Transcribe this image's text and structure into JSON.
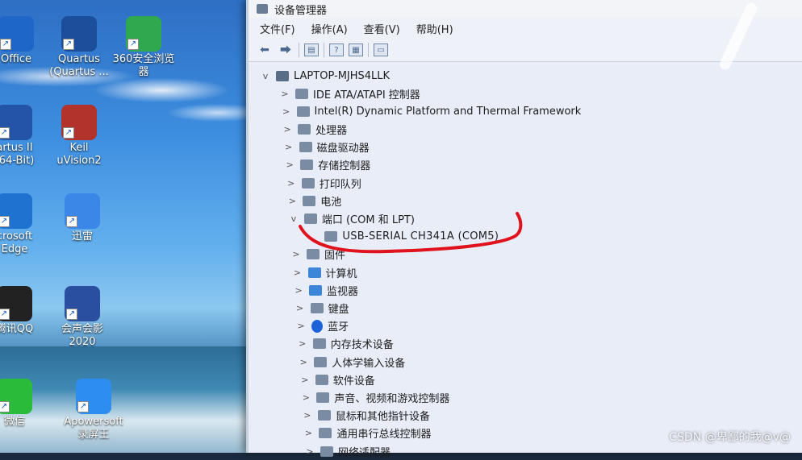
{
  "desktop": {
    "icons": [
      {
        "label": "Office",
        "icon": "office-icon",
        "color": "#1e66c8"
      },
      {
        "label": "Quartus\n(Quartus ...",
        "icon": "quartus-icon",
        "color": "#1b4f9c"
      },
      {
        "label": "360安全浏览\n器",
        "icon": "browser-360-icon",
        "color": "#2fa84f"
      },
      {
        "label": "artus II\n(64-Bit)",
        "icon": "quartus-ii-icon",
        "color": "#2454a8"
      },
      {
        "label": "Keil\nuVision2",
        "icon": "keil-icon",
        "color": "#b2332c"
      },
      {
        "label": "crosoft\nEdge",
        "icon": "edge-icon",
        "color": "#1f73d0"
      },
      {
        "label": "迅雷",
        "icon": "xunlei-icon",
        "color": "#3b87e8"
      },
      {
        "label": "腾讯QQ",
        "icon": "qq-icon",
        "color": "#222222"
      },
      {
        "label": "会声会影\n2020",
        "icon": "video-editor-icon",
        "color": "#2a4fa0"
      },
      {
        "label": "微信",
        "icon": "wechat-icon",
        "color": "#2bbb3a"
      },
      {
        "label": "Apowersoft\n录屏王",
        "icon": "screen-recorder-icon",
        "color": "#2d8df0"
      }
    ]
  },
  "window": {
    "title": "设备管理器",
    "menu": [
      "文件(F)",
      "操作(A)",
      "查看(V)",
      "帮助(H)"
    ],
    "toolbar": [
      "back-arrow-icon",
      "forward-arrow-icon",
      "properties-icon",
      "help-icon",
      "view-icon",
      "monitor-icon"
    ]
  },
  "tree": {
    "root": "LAPTOP-MJHS4LLK",
    "nodes": [
      {
        "label": "IDE ATA/ATAPI 控制器",
        "expander": ">",
        "icon": "ide-controller-icon"
      },
      {
        "label": "Intel(R) Dynamic Platform and Thermal Framework",
        "expander": ">",
        "icon": "intel-framework-icon"
      },
      {
        "label": "处理器",
        "expander": ">",
        "icon": "processor-icon"
      },
      {
        "label": "磁盘驱动器",
        "expander": ">",
        "icon": "disk-drive-icon"
      },
      {
        "label": "存储控制器",
        "expander": ">",
        "icon": "storage-controller-icon"
      },
      {
        "label": "打印队列",
        "expander": ">",
        "icon": "print-queue-icon"
      },
      {
        "label": "电池",
        "expander": ">",
        "icon": "battery-icon"
      },
      {
        "label": "端口 (COM 和 LPT)",
        "expander": "v",
        "icon": "port-icon"
      },
      {
        "label": "USB-SERIAL CH341A (COM5)",
        "expander": "",
        "icon": "serial-port-icon",
        "child": true
      },
      {
        "label": "固件",
        "expander": ">",
        "icon": "firmware-icon"
      },
      {
        "label": "计算机",
        "expander": ">",
        "icon": "computer-icon"
      },
      {
        "label": "监视器",
        "expander": ">",
        "icon": "monitor-icon"
      },
      {
        "label": "键盘",
        "expander": ">",
        "icon": "keyboard-icon"
      },
      {
        "label": "蓝牙",
        "expander": ">",
        "icon": "bluetooth-icon"
      },
      {
        "label": "内存技术设备",
        "expander": ">",
        "icon": "memory-device-icon"
      },
      {
        "label": "人体学输入设备",
        "expander": ">",
        "icon": "hid-icon"
      },
      {
        "label": "软件设备",
        "expander": ">",
        "icon": "software-device-icon"
      },
      {
        "label": "声音、视频和游戏控制器",
        "expander": ">",
        "icon": "sound-icon"
      },
      {
        "label": "鼠标和其他指针设备",
        "expander": ">",
        "icon": "mouse-icon"
      },
      {
        "label": "通用串行总线控制器",
        "expander": ">",
        "icon": "usb-controller-icon"
      },
      {
        "label": "网络适配器",
        "expander": ">",
        "icon": "network-adapter-icon"
      }
    ]
  },
  "annotation_color": "#e0121b",
  "watermark": "CSDN @卑鄙的我@v@"
}
